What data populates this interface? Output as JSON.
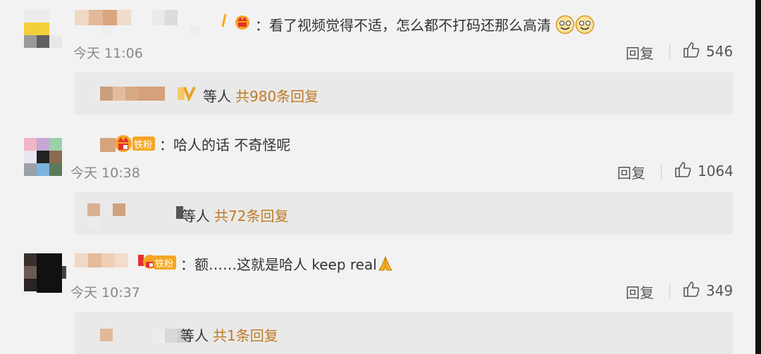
{
  "comments": [
    {
      "text": "：看了视频觉得不适，怎么都不打码还那么高清",
      "time": "今天 11:06",
      "reply_label": "回复",
      "likes": "546",
      "replies": {
        "suffix": "等人",
        "total": "共980条回复"
      }
    },
    {
      "badge": "铁粉",
      "text": "：哈人的话  不奇怪呢",
      "time": "今天 10:38",
      "reply_label": "回复",
      "likes": "1064",
      "replies": {
        "suffix": "等人",
        "total": "共72条回复"
      }
    },
    {
      "badge": "铁粉",
      "text": "：额……这就是哈人 keep real",
      "time": "今天 10:37",
      "reply_label": "回复",
      "likes": "349",
      "replies": {
        "suffix": "等人",
        "total": "共1条回复"
      }
    }
  ],
  "colors": {
    "background": "#f2f2f2",
    "reply_box": "#e9e9e9",
    "accent": "#c07a25",
    "badge": "#f5a623"
  },
  "icons": {
    "like": "thumbs-up-icon",
    "emoji_smile": "smile-emoji-icon",
    "emoji_pray": "pray-emoji-icon",
    "vip": "vip-crown-icon"
  }
}
